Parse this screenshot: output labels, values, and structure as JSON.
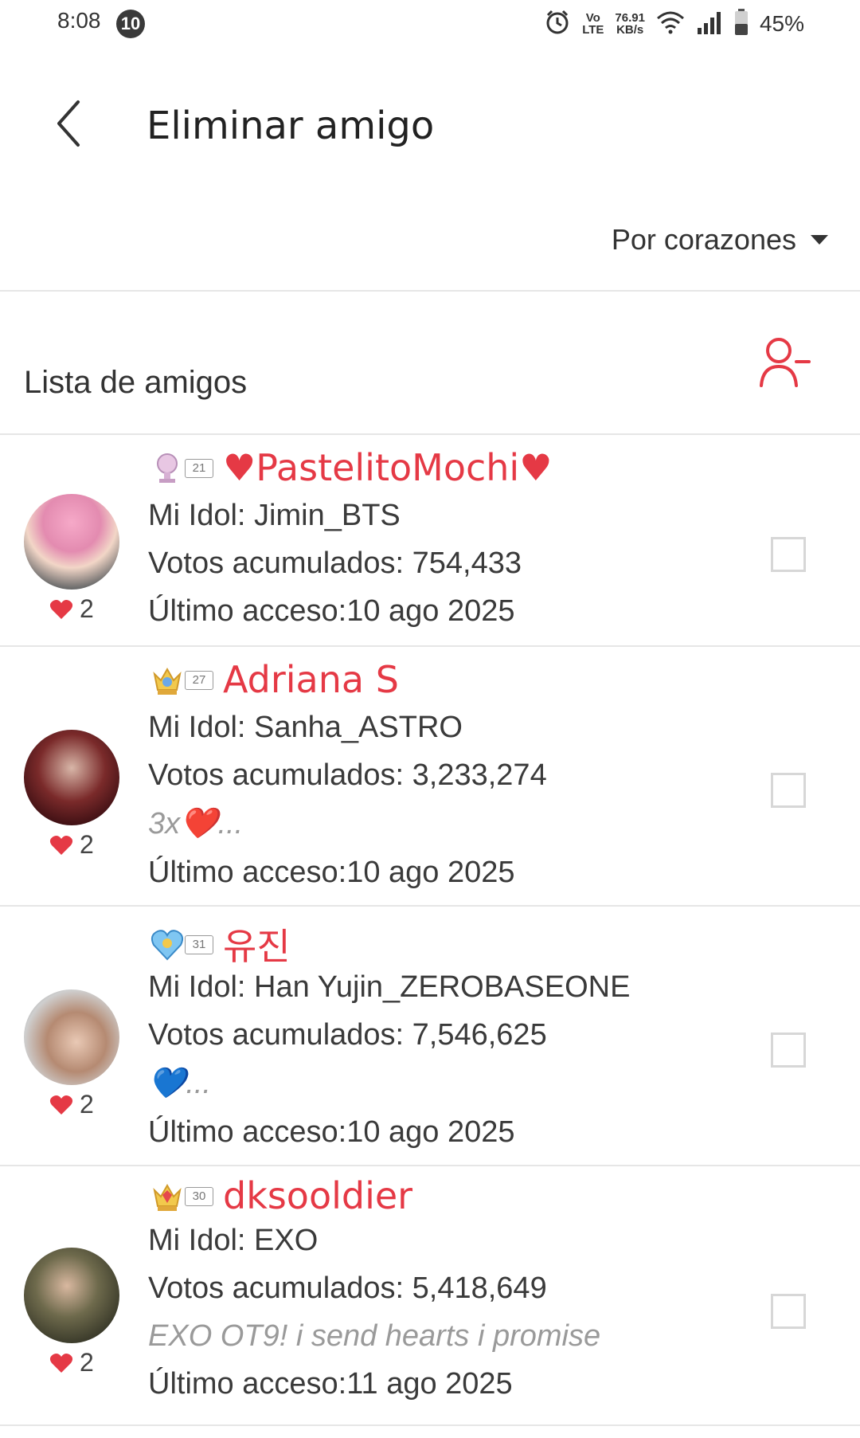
{
  "status_bar": {
    "time": "8:08",
    "notification_count": "10",
    "volte_top": "Vo",
    "volte_bottom": "LTE",
    "speed_top": "76.91",
    "speed_bottom": "KB/s",
    "battery": "45%"
  },
  "header": {
    "title": "Eliminar amigo"
  },
  "sort": {
    "label": "Por corazones"
  },
  "list": {
    "title": "Lista de amigos"
  },
  "colors": {
    "accent": "#e53945",
    "divider": "#e6e6e6"
  },
  "friends": [
    {
      "level": "21",
      "username": "♥PastelitoMochi♥",
      "idol": "Mi Idol: Jimin_BTS",
      "votes": "Votos acumulados: 754,433",
      "status": "",
      "last_access": "Último acceso:10 ago 2025",
      "hearts": "2"
    },
    {
      "level": "27",
      "username": "Adriana S",
      "idol": "Mi Idol: Sanha_ASTRO",
      "votes": "Votos acumulados: 3,233,274",
      "status": "3x❤️...",
      "last_access": "Último acceso:10 ago 2025",
      "hearts": "2"
    },
    {
      "level": "31",
      "username": "유진",
      "idol": "Mi Idol: Han Yujin_ZEROBASEONE",
      "votes": "Votos acumulados: 7,546,625",
      "status": "💙...",
      "last_access": "Último acceso:10 ago 2025",
      "hearts": "2"
    },
    {
      "level": "30",
      "username": "dksooldier",
      "idol": "Mi Idol: EXO",
      "votes": "Votos acumulados: 5,418,649",
      "status": "EXO OT9! i send hearts i promise",
      "last_access": "Último acceso:11 ago 2025",
      "hearts": "2"
    }
  ]
}
